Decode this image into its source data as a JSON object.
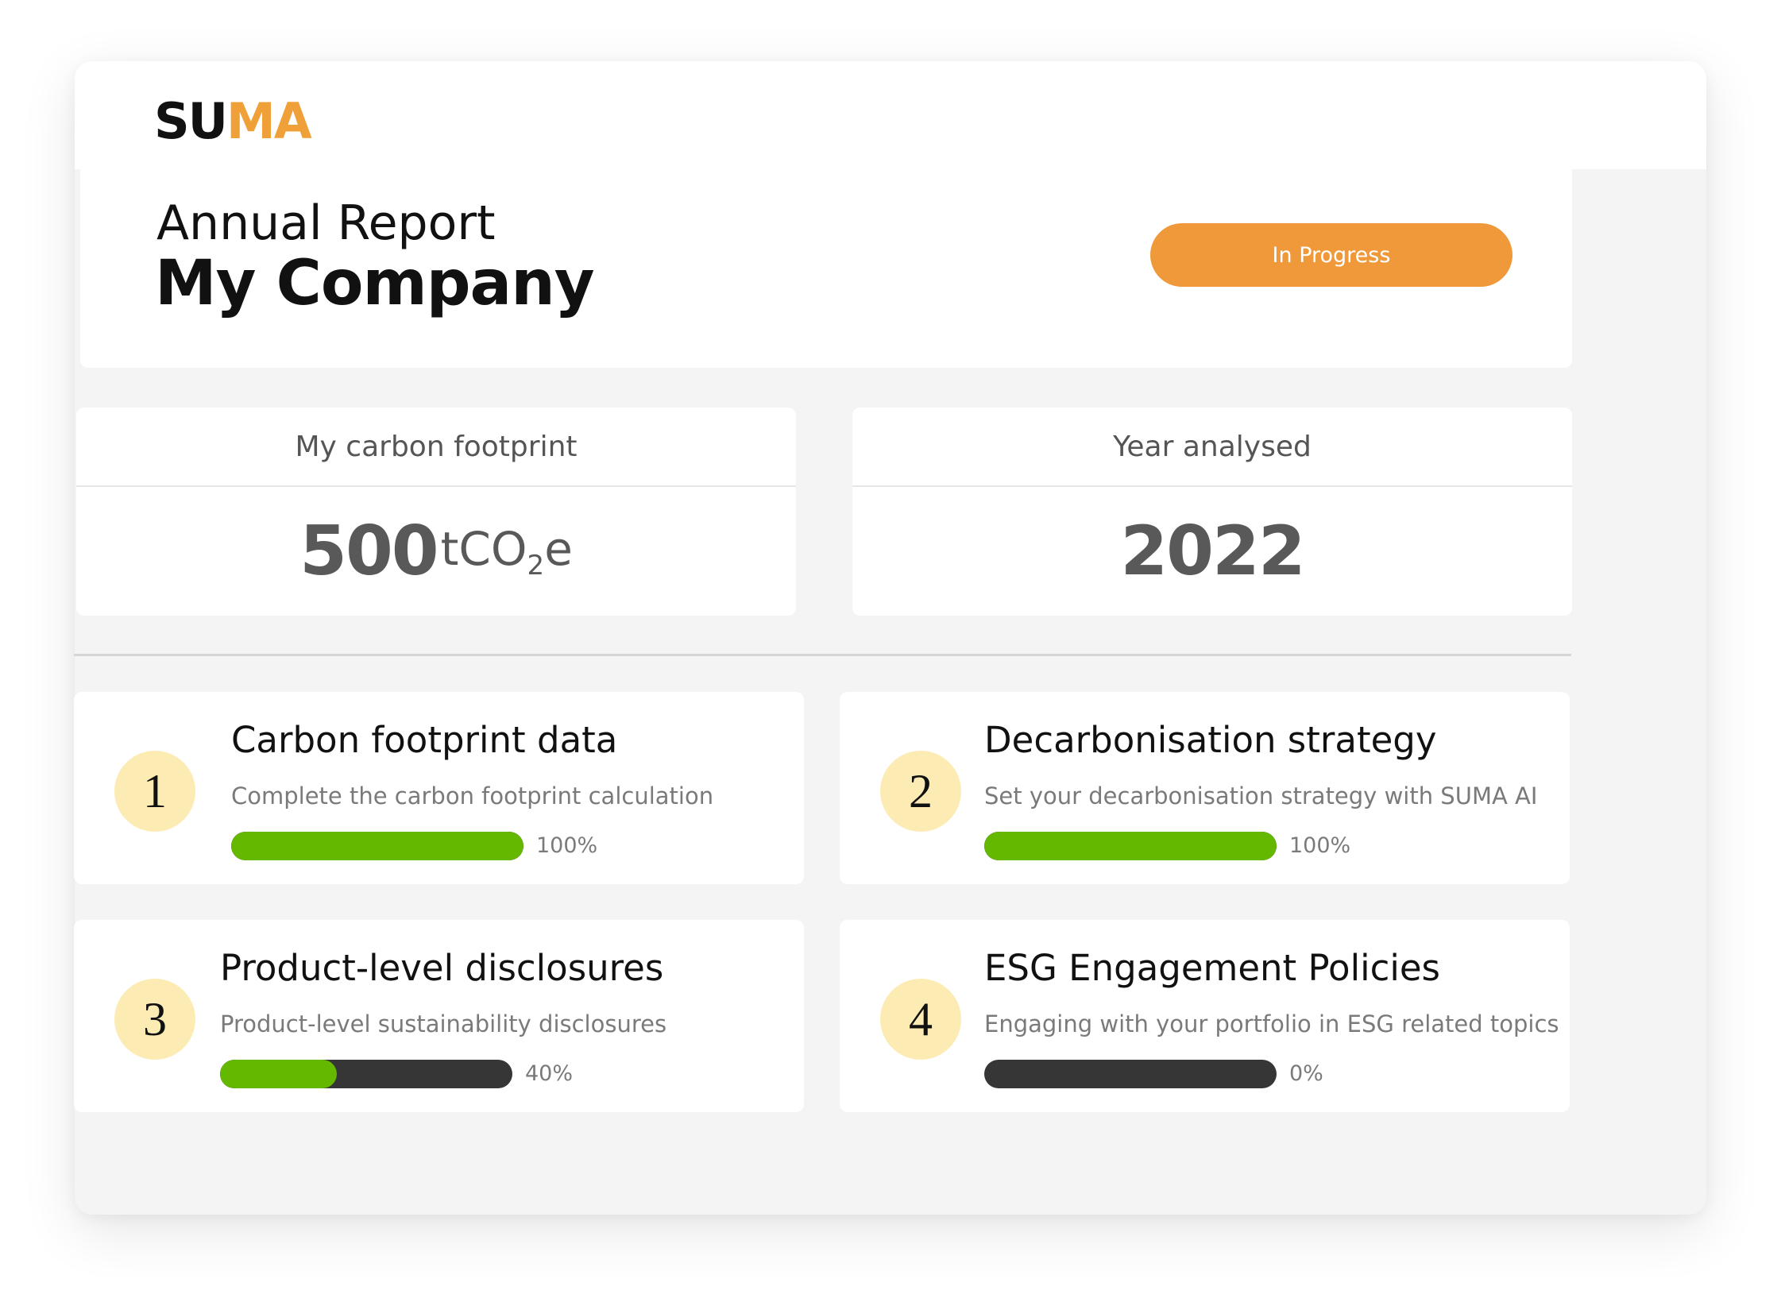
{
  "app": {
    "logo": {
      "part1": "SU",
      "part2": "MA"
    }
  },
  "header": {
    "report_label": "Annual Report",
    "company_name": "My Company",
    "status": "In Progress"
  },
  "stats": {
    "carbon": {
      "label": "My carbon footprint",
      "value": "500",
      "unit_main": "tCO",
      "unit_sub": "2",
      "unit_tail": "e"
    },
    "year": {
      "label": "Year analysed",
      "value": "2022"
    }
  },
  "tasks": [
    {
      "number": "1",
      "title": "Carbon footprint data",
      "description": "Complete the carbon footprint calculation",
      "progress": 1.0,
      "progress_label": "100%"
    },
    {
      "number": "2",
      "title": "Decarbonisation strategy",
      "description": "Set your decarbonisation strategy with SUMA AI",
      "progress": 1.0,
      "progress_label": "100%"
    },
    {
      "number": "3",
      "title": "Product-level disclosures",
      "description": "Product-level sustainability disclosures",
      "progress": 0.4,
      "progress_label": "40%"
    },
    {
      "number": "4",
      "title": "ESG Engagement Policies",
      "description": "Engaging with your portfolio in ESG related topics",
      "progress": 0.0,
      "progress_label": "0%"
    }
  ],
  "colors": {
    "accent": "#f0993a",
    "progress_fill": "#65b800",
    "progress_track": "#363636",
    "step_circle": "#fcecb4"
  }
}
